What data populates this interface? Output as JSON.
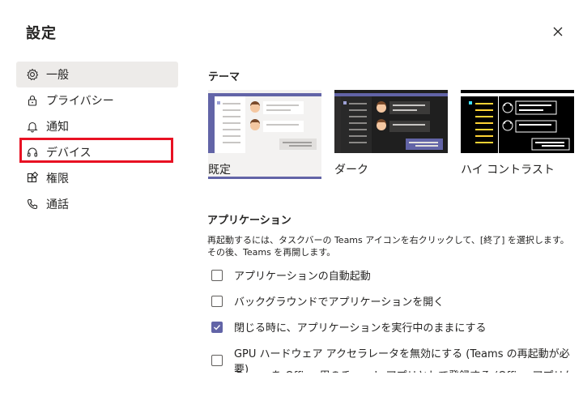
{
  "dialog": {
    "title": "設定"
  },
  "nav": {
    "items": [
      {
        "label": "一般",
        "icon": "gear-icon",
        "active": true
      },
      {
        "label": "プライバシー",
        "icon": "lock-icon"
      },
      {
        "label": "通知",
        "icon": "bell-icon"
      },
      {
        "label": "デバイス",
        "icon": "headset-icon"
      },
      {
        "label": "権限",
        "icon": "apps-icon"
      },
      {
        "label": "通話",
        "icon": "phone-icon"
      }
    ]
  },
  "theme": {
    "heading": "テーマ",
    "options": [
      {
        "label": "既定",
        "selected": true
      },
      {
        "label": "ダーク"
      },
      {
        "label": "ハイ コントラスト"
      }
    ]
  },
  "application": {
    "heading": "アプリケーション",
    "description": "再起動するには、タスクバーの Teams アイコンを右クリックして、[終了] を選択します。その後、Teams を再開します。",
    "options": [
      {
        "label": "アプリケーションの自動起動",
        "checked": false
      },
      {
        "label": "バックグラウンドでアプリケーションを開く",
        "checked": false
      },
      {
        "label": "閉じる時に、アプリケーションを実行中のままにする",
        "checked": true
      },
      {
        "label": "GPU ハードウェア アクセラレータを無効にする (Teams の再起動が必要)",
        "checked": false
      },
      {
        "label": "Teams を Office 用のチャット アプリとして登録する (Office アプリケーションの",
        "checked": false
      }
    ]
  },
  "colors": {
    "accent": "#6264a7",
    "highlight": "#e81123"
  }
}
